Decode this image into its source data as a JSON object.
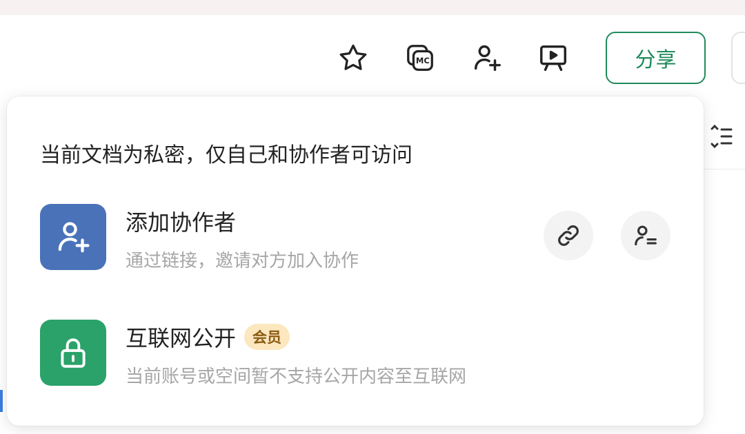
{
  "toolbar": {
    "icons": [
      "star-icon",
      "mc-copy-icon",
      "add-user-icon",
      "presentation-icon"
    ],
    "share_label": "分享"
  },
  "share_panel": {
    "status_text": "当前文档为私密，仅自己和协作者可访问",
    "add_collaborator": {
      "title": "添加协作者",
      "description": "通过链接，邀请对方加入协作",
      "icon": "add-user-icon",
      "actions": [
        "link-icon",
        "user-list-icon"
      ]
    },
    "public_web": {
      "title": "互联网公开",
      "badge": "会员",
      "description": "当前账号或空间暂不支持公开内容至互联网",
      "icon": "lock-icon"
    }
  },
  "colors": {
    "accent_green": "#1f8a5a",
    "collab_blue": "#4a72b8",
    "public_green": "#2aa269",
    "badge_bg": "#fce7bf",
    "badge_text": "#8a5a12"
  }
}
